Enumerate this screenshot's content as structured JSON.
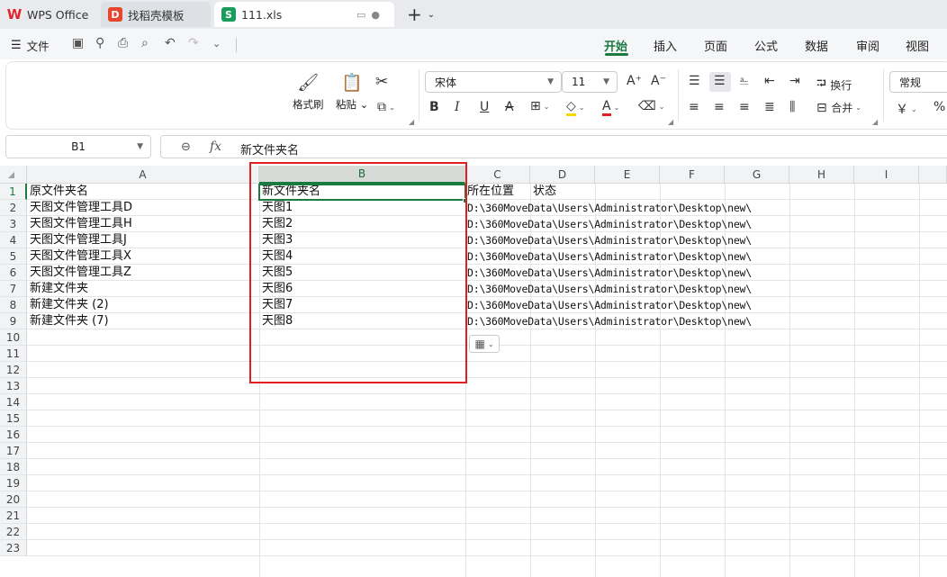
{
  "tabs": {
    "wps": "WPS Office",
    "template": "找稻壳模板",
    "file": "111.xls",
    "add": "+"
  },
  "menu": {
    "file": "文件",
    "tabs": [
      "开始",
      "插入",
      "页面",
      "公式",
      "数据",
      "审阅",
      "视图"
    ],
    "active": "开始"
  },
  "ribbon": {
    "format_painter": "格式刷",
    "paste": "粘贴",
    "font_name": "宋体",
    "font_size": "11",
    "wrap_text": "换行",
    "merge": "合并",
    "number_format": "常规",
    "currency_symbol": "￥",
    "percent_symbol": "%"
  },
  "formula_bar": {
    "name_box": "B1",
    "fx": "fx",
    "value": "新文件夹名"
  },
  "sheet": {
    "columns": [
      "A",
      "B",
      "C",
      "D",
      "E",
      "F",
      "G",
      "H",
      "I"
    ],
    "selected_column": "B",
    "rows": [
      "1",
      "2",
      "3",
      "4",
      "5",
      "6",
      "7",
      "8",
      "9",
      "10",
      "11",
      "12",
      "13",
      "14",
      "15",
      "16",
      "17",
      "18",
      "19",
      "20",
      "21",
      "22",
      "23"
    ],
    "selected_row": "1",
    "colA": [
      "原文件夹名",
      "天图文件管理工具D",
      "天图文件管理工具H",
      "天图文件管理工具J",
      "天图文件管理工具X",
      "天图文件管理工具Z",
      "新建文件夹",
      "新建文件夹 (2)",
      "新建文件夹 (7)"
    ],
    "colB": [
      "新文件夹名",
      "天图1",
      "天图2",
      "天图3",
      "天图4",
      "天图5",
      "天图6",
      "天图7",
      "天图8"
    ],
    "colC": [
      "所在位置",
      "D:\\360MoveData\\Users\\Administrator\\Desktop\\new\\",
      "D:\\360MoveData\\Users\\Administrator\\Desktop\\new\\",
      "D:\\360MoveData\\Users\\Administrator\\Desktop\\new\\",
      "D:\\360MoveData\\Users\\Administrator\\Desktop\\new\\",
      "D:\\360MoveData\\Users\\Administrator\\Desktop\\new\\",
      "D:\\360MoveData\\Users\\Administrator\\Desktop\\new\\",
      "D:\\360MoveData\\Users\\Administrator\\Desktop\\new\\",
      "D:\\360MoveData\\Users\\Administrator\\Desktop\\new\\"
    ],
    "colD": [
      "状态"
    ]
  },
  "colors": {
    "accent": "#1b7a3f",
    "highlight_box": "#e02020"
  }
}
